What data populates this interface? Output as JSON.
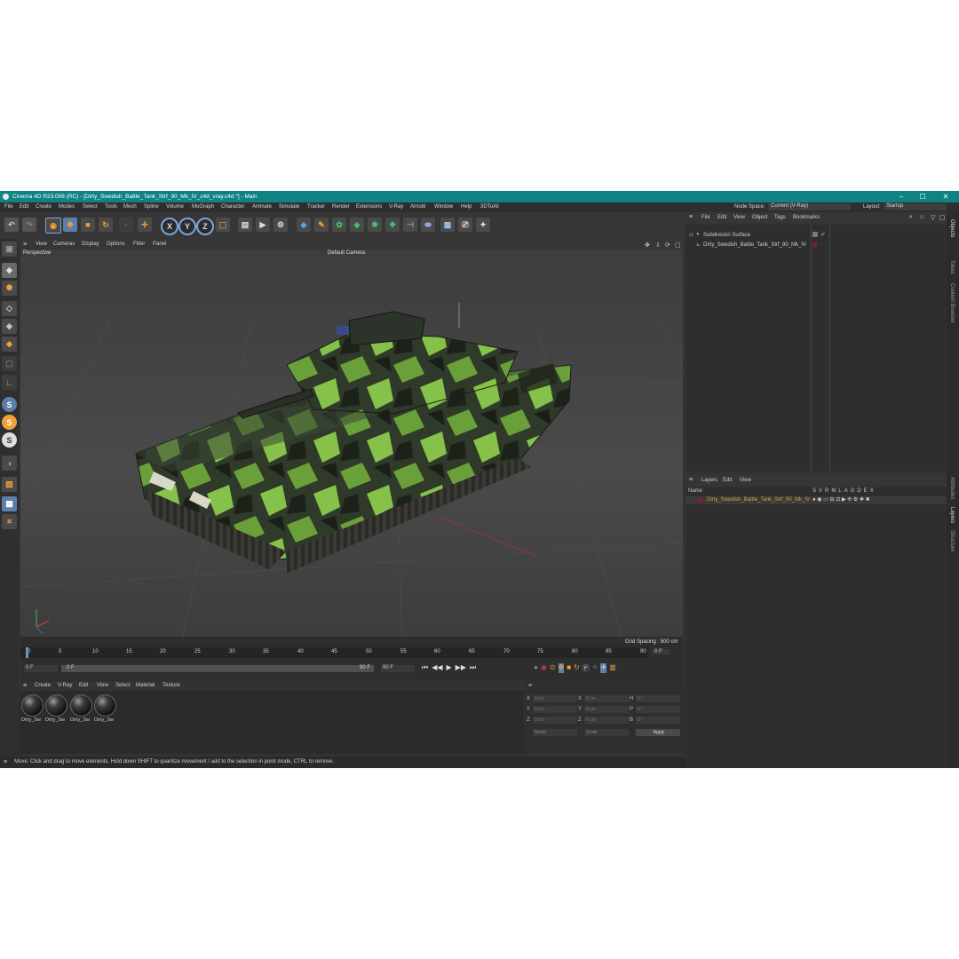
{
  "window": {
    "title": "Cinema 4D R23.008 (RC) - [Dirty_Swedish_Battle_Tank_Strf_90_Mk_IV_c4d_vray.c4d *] - Main",
    "controls": [
      "–",
      "☐",
      "✕"
    ]
  },
  "menu": [
    "File",
    "Edit",
    "Create",
    "Modes",
    "Select",
    "Tools",
    "Mesh",
    "Spline",
    "Volume",
    "MoGraph",
    "Character",
    "Animate",
    "Simulate",
    "Tracker",
    "Render",
    "Extensions",
    "V-Ray",
    "Arnold",
    "Window",
    "Help",
    "3DToAll"
  ],
  "node_space": {
    "label": "Node Space:",
    "value": "Current (V-Ray)"
  },
  "layout": {
    "label": "Layout:",
    "value": "Startup"
  },
  "toolbar_axes": [
    "X",
    "Y",
    "Z"
  ],
  "left_tools": {
    "s_labels": [
      "S",
      "S",
      "S"
    ]
  },
  "viewport": {
    "menu": [
      "View",
      "Cameras",
      "Display",
      "Options",
      "Filter",
      "Panel"
    ],
    "label": "Perspective",
    "camera": "Default Camera",
    "grid_spacing": "Grid Spacing : 500 cm"
  },
  "timeline": {
    "ticks": [
      "0",
      "5",
      "10",
      "15",
      "20",
      "25",
      "30",
      "35",
      "40",
      "45",
      "50",
      "55",
      "60",
      "65",
      "70",
      "75",
      "80",
      "85",
      "90"
    ],
    "current_frame": "0 F",
    "start": "0 F",
    "start2": "0 F",
    "end": "90 F",
    "end2": "90 F",
    "end_field": "0 F"
  },
  "material_menu": [
    "Create",
    "V-Ray",
    "Edit",
    "View",
    "Select",
    "Material",
    "Texture"
  ],
  "materials": [
    "Dirty_Sw",
    "Dirty_Sw",
    "Dirty_Sw",
    "Dirty_Sw"
  ],
  "coords": {
    "rows": [
      {
        "a": "X",
        "av": "0 cm",
        "b": "X",
        "bv": "0 cm",
        "c": "H",
        "cv": "0 °"
      },
      {
        "a": "Y",
        "av": "0 cm",
        "b": "Y",
        "bv": "0 cm",
        "c": "P",
        "cv": "0 °"
      },
      {
        "a": "Z",
        "av": "0 cm",
        "b": "Z",
        "bv": "0 cm",
        "c": "B",
        "cv": "0 °"
      }
    ],
    "mode1": "World",
    "mode2": "Scale",
    "apply": "Apply"
  },
  "status": "Move: Click and drag to move elements. Hold down SHIFT to quantize movement / add to the selection in point mode, CTRL to remove.",
  "objects_menu": [
    "File",
    "Edit",
    "View",
    "Object",
    "Tags",
    "Bookmarks"
  ],
  "objects": [
    {
      "name": "Subdivision Surface"
    },
    {
      "name": "Dirty_Swedish_Battle_Tank_Strf_90_Mk_IV"
    }
  ],
  "layers_menu": [
    "Layers",
    "Edit",
    "View"
  ],
  "layers_header": {
    "name": "Name",
    "cols": [
      "S",
      "V",
      "R",
      "M",
      "L",
      "A",
      "G",
      "D",
      "E",
      "X"
    ]
  },
  "layers": [
    {
      "name": "Dirty_Swedish_Battle_Tank_Strf_90_Mk_IV"
    }
  ],
  "right_tabs": [
    "Objects",
    "Takes",
    "Content Browser",
    "Attributes",
    "Layers",
    "Structure"
  ],
  "colors": {
    "titlebar": "#0f8383",
    "layer_name": "#d8a23a",
    "accent": "#f2a13a"
  }
}
